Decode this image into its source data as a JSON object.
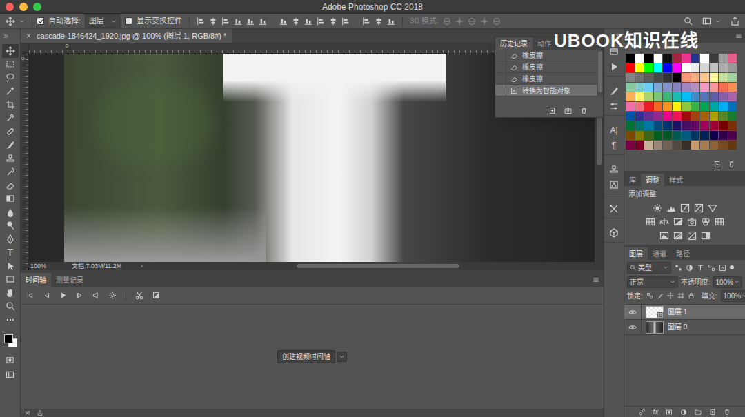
{
  "window": {
    "title": "Adobe Photoshop CC 2018"
  },
  "options_bar": {
    "auto_select": {
      "label": "自动选择:",
      "checked": true
    },
    "target": "图层",
    "show_transform": {
      "label": "显示变换控件",
      "checked": false
    },
    "mode_3d": {
      "label": "3D 模式:",
      "disabled": true
    }
  },
  "toolbar": {
    "tools": [
      {
        "kind": "move",
        "selected": true
      },
      {
        "kind": "marquee",
        "selected": false
      },
      {
        "kind": "lasso",
        "selected": false
      },
      {
        "kind": "quick-select",
        "selected": false
      },
      {
        "kind": "crop",
        "selected": false
      },
      {
        "kind": "eyedropper",
        "selected": false
      },
      {
        "kind": "healing",
        "selected": false
      },
      {
        "kind": "brush",
        "selected": false
      },
      {
        "kind": "stamp",
        "selected": false
      },
      {
        "kind": "history-brush",
        "selected": false
      },
      {
        "kind": "eraser",
        "selected": false
      },
      {
        "kind": "gradient",
        "selected": false
      },
      {
        "kind": "blur",
        "selected": false
      },
      {
        "kind": "dodge",
        "selected": false
      },
      {
        "kind": "pen",
        "selected": false
      },
      {
        "kind": "type",
        "label": "T",
        "selected": false
      },
      {
        "kind": "path-select",
        "selected": false
      },
      {
        "kind": "rectangle",
        "selected": false
      },
      {
        "kind": "hand",
        "selected": false
      },
      {
        "kind": "zoom",
        "selected": false
      },
      {
        "kind": "more",
        "selected": false
      }
    ],
    "foreground_color": "#000000",
    "background_color": "#ffffff"
  },
  "document": {
    "tab": "cascade-1846424_1920.jpg @ 100% (图层 1, RGB/8#) *",
    "close": "×",
    "ruler_top": "0",
    "ruler_left": "0",
    "status": {
      "zoom": "100%",
      "doc": "文档:7.03M/11.2M",
      "arrow": "›"
    }
  },
  "history": {
    "tabs": [
      {
        "label": "历史记录",
        "selected": true
      },
      {
        "label": "动作",
        "selected": false
      }
    ],
    "items": [
      {
        "label": "橡皮擦",
        "kind": "eraser",
        "selected": false
      },
      {
        "label": "橡皮擦",
        "kind": "eraser",
        "selected": false
      },
      {
        "label": "橡皮擦",
        "kind": "eraser",
        "selected": false
      },
      {
        "label": "转换为智能对象",
        "kind": "smart-object",
        "selected": true
      }
    ]
  },
  "timeline": {
    "tabs": [
      {
        "label": "时间轴",
        "selected": true
      },
      {
        "label": "测量记录",
        "selected": false
      }
    ],
    "create_button": "创建视频时间轴"
  },
  "dock": {
    "groups": [
      [
        {
          "kind": "actions"
        },
        {
          "kind": "play"
        }
      ],
      [
        {
          "kind": "brush"
        },
        {
          "kind": "sliders"
        }
      ],
      [
        {
          "kind": "glyph",
          "label": "A|"
        },
        {
          "kind": "glyph",
          "label": "¶"
        }
      ],
      [
        {
          "kind": "clone"
        },
        {
          "kind": "glyphs"
        }
      ],
      [
        {
          "kind": "tools"
        }
      ],
      [
        {
          "kind": "cube"
        }
      ]
    ]
  },
  "swatches": [
    {
      "color": "#000000"
    },
    {
      "color": "#ffffff"
    },
    {
      "color": "#000000"
    },
    {
      "color": "#ffffff"
    },
    {
      "color": "#111111"
    },
    {
      "color": "#a0263e"
    },
    {
      "color": "#e8358e"
    },
    {
      "color": "#25358a"
    },
    {
      "color": "#ffffff"
    },
    {
      "color": "#3b3b3b"
    },
    {
      "color": "#9c9c9c"
    },
    {
      "color": "#e75b8a"
    },
    {
      "color": "#ff0000"
    },
    {
      "color": "#ffff00"
    },
    {
      "color": "#00ff00"
    },
    {
      "color": "#00ffff"
    },
    {
      "color": "#0000ff"
    },
    {
      "color": "#ff00ff"
    },
    {
      "color": "#ffffff"
    },
    {
      "color": "#ebebeb"
    },
    {
      "color": "#d6d6d6"
    },
    {
      "color": "#c2c2c2"
    },
    {
      "color": "#adadad"
    },
    {
      "color": "#999999"
    },
    {
      "color": "#858585"
    },
    {
      "color": "#707070"
    },
    {
      "color": "#5c5c5c"
    },
    {
      "color": "#474747"
    },
    {
      "color": "#333333"
    },
    {
      "color": "#000000"
    },
    {
      "color": "#f7977a"
    },
    {
      "color": "#f9ad81"
    },
    {
      "color": "#fdc68a"
    },
    {
      "color": "#fff79a"
    },
    {
      "color": "#c4df9b"
    },
    {
      "color": "#a3d39c"
    },
    {
      "color": "#82ca9d"
    },
    {
      "color": "#7bcdc8"
    },
    {
      "color": "#6ecff6"
    },
    {
      "color": "#7ea7d8"
    },
    {
      "color": "#8493ca"
    },
    {
      "color": "#8882be"
    },
    {
      "color": "#a187be"
    },
    {
      "color": "#bc8dbf"
    },
    {
      "color": "#f49ac2"
    },
    {
      "color": "#f6989d"
    },
    {
      "color": "#f26c4f"
    },
    {
      "color": "#f68e55"
    },
    {
      "color": "#fbaf5c"
    },
    {
      "color": "#fff467"
    },
    {
      "color": "#acd372"
    },
    {
      "color": "#7cc576"
    },
    {
      "color": "#3bb878"
    },
    {
      "color": "#1abbb4"
    },
    {
      "color": "#00bff3"
    },
    {
      "color": "#438ccb"
    },
    {
      "color": "#5574b9"
    },
    {
      "color": "#605ca8"
    },
    {
      "color": "#855fa8"
    },
    {
      "color": "#a763a8"
    },
    {
      "color": "#f06ea9"
    },
    {
      "color": "#f26d7d"
    },
    {
      "color": "#ed1c24"
    },
    {
      "color": "#f26522"
    },
    {
      "color": "#f7941d"
    },
    {
      "color": "#fff200"
    },
    {
      "color": "#8dc73f"
    },
    {
      "color": "#39b54a"
    },
    {
      "color": "#00a651"
    },
    {
      "color": "#00a99d"
    },
    {
      "color": "#00aeef"
    },
    {
      "color": "#0072bc"
    },
    {
      "color": "#0054a6"
    },
    {
      "color": "#2e3192"
    },
    {
      "color": "#662d91"
    },
    {
      "color": "#92278f"
    },
    {
      "color": "#ec008c"
    },
    {
      "color": "#ed145b"
    },
    {
      "color": "#9e0b0f"
    },
    {
      "color": "#a0410d"
    },
    {
      "color": "#a36209"
    },
    {
      "color": "#aba000"
    },
    {
      "color": "#598527"
    },
    {
      "color": "#197b30"
    },
    {
      "color": "#007236"
    },
    {
      "color": "#00746b"
    },
    {
      "color": "#0076a3"
    },
    {
      "color": "#004b80"
    },
    {
      "color": "#003471"
    },
    {
      "color": "#1b1464"
    },
    {
      "color": "#440e62"
    },
    {
      "color": "#630460"
    },
    {
      "color": "#9e005d"
    },
    {
      "color": "#9e0039"
    },
    {
      "color": "#790000"
    },
    {
      "color": "#7b2e00"
    },
    {
      "color": "#7d4900"
    },
    {
      "color": "#827b00"
    },
    {
      "color": "#406618"
    },
    {
      "color": "#005e20"
    },
    {
      "color": "#005826"
    },
    {
      "color": "#005952"
    },
    {
      "color": "#005b7f"
    },
    {
      "color": "#003663"
    },
    {
      "color": "#002157"
    },
    {
      "color": "#0d004c"
    },
    {
      "color": "#32004b"
    },
    {
      "color": "#4b0049"
    },
    {
      "color": "#7b0046"
    },
    {
      "color": "#7a0026"
    },
    {
      "color": "#c7b299"
    },
    {
      "color": "#998675"
    },
    {
      "color": "#736357"
    },
    {
      "color": "#534741"
    },
    {
      "color": "#37302a"
    },
    {
      "color": "#c69c6d"
    },
    {
      "color": "#a67c52"
    },
    {
      "color": "#8c6239"
    },
    {
      "color": "#754c24"
    },
    {
      "color": "#603913"
    }
  ],
  "adjustments": {
    "tabs": [
      {
        "label": "库",
        "selected": false
      },
      {
        "label": "调整",
        "selected": true
      },
      {
        "label": "样式",
        "selected": false
      }
    ],
    "heading": "添加调整"
  },
  "layers": {
    "tabs": [
      {
        "label": "图层",
        "selected": true
      },
      {
        "label": "通道",
        "selected": false
      },
      {
        "label": "路径",
        "selected": false
      }
    ],
    "filter": "类型",
    "blend_mode": "正常",
    "opacity_label": "不透明度:",
    "opacity": "100%",
    "lock_label": "锁定:",
    "fill_label": "填充:",
    "fill": "100%",
    "items": [
      {
        "name": "图层 1",
        "visible": true,
        "selected": true,
        "kind": "smart-object"
      },
      {
        "name": "图层 0",
        "visible": true,
        "selected": false,
        "kind": "image"
      }
    ],
    "fx": "fx"
  },
  "watermark": "UBOOK知识在线"
}
